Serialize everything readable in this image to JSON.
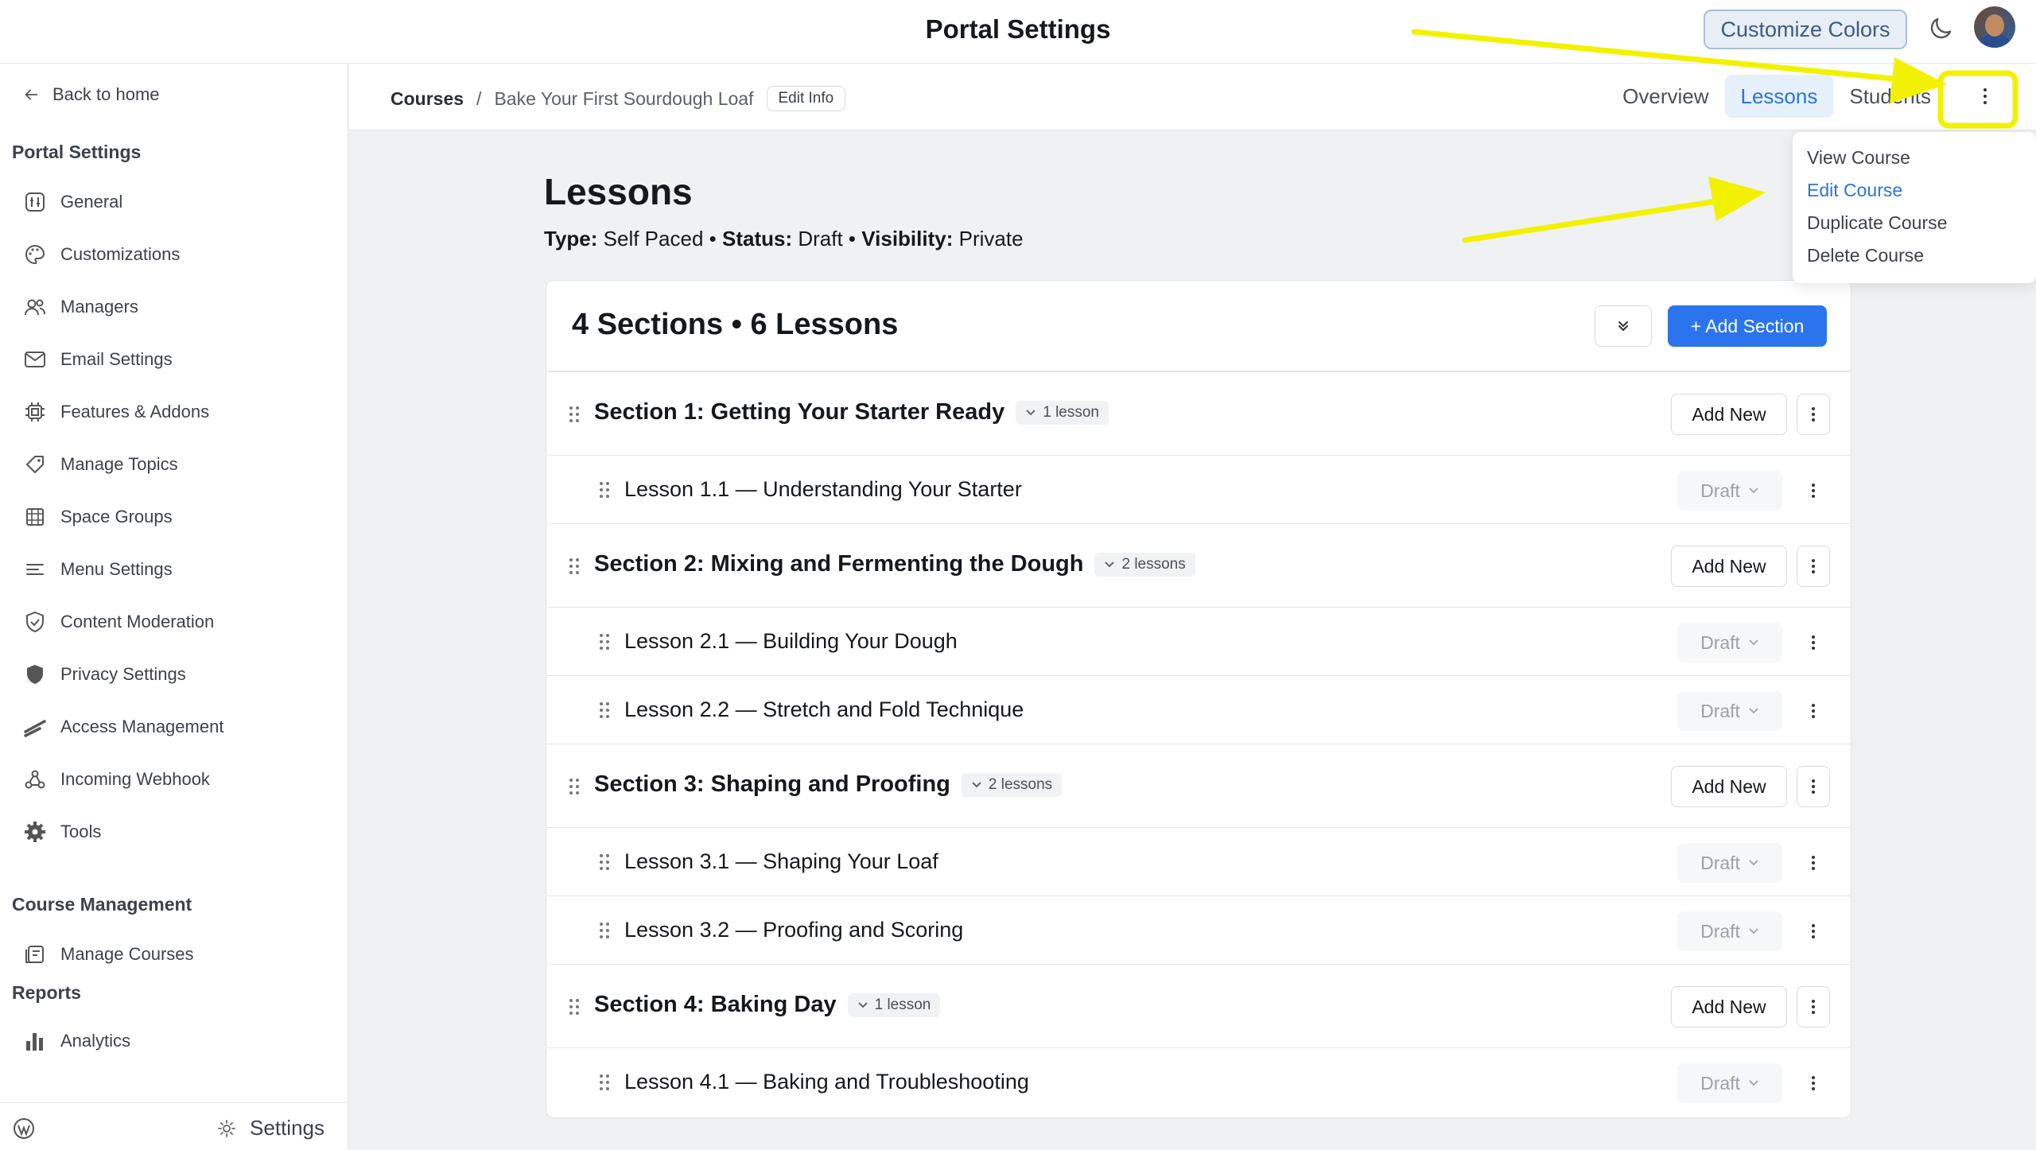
{
  "topbar": {
    "title": "Portal Settings",
    "customize_label": "Customize Colors"
  },
  "sidebar": {
    "back_label": "Back to home",
    "portal_heading": "Portal Settings",
    "items": [
      {
        "label": "General",
        "icon": "general-icon"
      },
      {
        "label": "Customizations",
        "icon": "palette-icon"
      },
      {
        "label": "Managers",
        "icon": "users-icon"
      },
      {
        "label": "Email Settings",
        "icon": "mail-icon"
      },
      {
        "label": "Features & Addons",
        "icon": "chip-icon"
      },
      {
        "label": "Manage Topics",
        "icon": "tag-icon"
      },
      {
        "label": "Space Groups",
        "icon": "grid-icon"
      },
      {
        "label": "Menu Settings",
        "icon": "menu-icon"
      },
      {
        "label": "Content Moderation",
        "icon": "shield-check-icon"
      },
      {
        "label": "Privacy Settings",
        "icon": "shield-icon"
      },
      {
        "label": "Access Management",
        "icon": "access-icon"
      },
      {
        "label": "Incoming Webhook",
        "icon": "webhook-icon"
      },
      {
        "label": "Tools",
        "icon": "gear-icon"
      }
    ],
    "course_heading": "Course Management",
    "course_items": [
      {
        "label": "Manage Courses",
        "icon": "courses-icon"
      }
    ],
    "reports_heading": "Reports",
    "report_items": [
      {
        "label": "Analytics",
        "icon": "bar-chart-icon"
      }
    ],
    "footer_settings": "Settings"
  },
  "subheader": {
    "breadcrumb_root": "Courses",
    "breadcrumb_sep": "/",
    "breadcrumb_current": "Bake Your First Sourdough Loaf",
    "edit_info": "Edit Info",
    "tabs": [
      "Overview",
      "Lessons",
      "Students"
    ]
  },
  "dropdown": {
    "items": [
      "View Course",
      "Edit Course",
      "Duplicate Course",
      "Delete Course"
    ]
  },
  "main": {
    "title": "Lessons",
    "meta": {
      "type_label": "Type:",
      "type_value": "Self Paced",
      "status_label": "Status:",
      "status_value": "Draft",
      "visibility_label": "Visibility:",
      "visibility_value": "Private",
      "separator": "•"
    },
    "summary": "4 Sections • 6 Lessons",
    "add_section": "+ Add Section",
    "add_new": "Add New",
    "draft_label": "Draft",
    "sections": [
      {
        "title": "Section 1: Getting Your Starter Ready",
        "count": "1 lesson",
        "lessons": [
          "Lesson 1.1 — Understanding Your Starter"
        ]
      },
      {
        "title": "Section 2: Mixing and Fermenting the Dough",
        "count": "2 lessons",
        "lessons": [
          "Lesson 2.1 — Building Your Dough",
          "Lesson 2.2 — Stretch and Fold Technique"
        ]
      },
      {
        "title": "Section 3: Shaping and Proofing",
        "count": "2 lessons",
        "lessons": [
          "Lesson 3.1 — Shaping Your Loaf",
          "Lesson 3.2 — Proofing and Scoring"
        ]
      },
      {
        "title": "Section 4: Baking Day",
        "count": "1 lesson",
        "lessons": [
          "Lesson 4.1 — Baking and Troubleshooting"
        ]
      }
    ]
  },
  "colors": {
    "accent": "#2b74ee",
    "annotation": "#f2f200"
  }
}
